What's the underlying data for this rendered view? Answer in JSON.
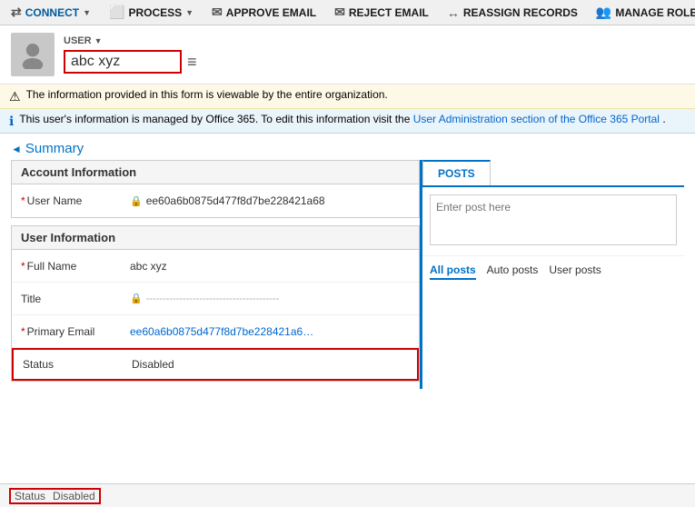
{
  "toolbar": {
    "connect_label": "CONNECT",
    "process_label": "PROCESS",
    "approve_email_label": "APPROVE EMAIL",
    "reject_email_label": "REJECT EMAIL",
    "reassign_records_label": "REASSIGN RECORDS",
    "manage_roles_label": "MANAGE ROLES"
  },
  "header": {
    "user_label": "USER",
    "name_value": "abc xyz"
  },
  "notices": {
    "warning_text": "The information provided in this form is viewable by the entire organization.",
    "info_text": "This user's information is managed by Office 365. To edit this information visit the ",
    "info_link": "User Administration section of the Office 365 Portal",
    "info_text2": "."
  },
  "summary": {
    "label": "Summary"
  },
  "account_section": {
    "header": "Account Information",
    "username_label": "User Name",
    "username_value": "ee60a6b0875d477f8d7be228421a68"
  },
  "user_section": {
    "header": "User Information",
    "fullname_label": "Full Name",
    "fullname_value": "abc xyz",
    "title_label": "Title",
    "title_value": "----------------------------------------",
    "email_label": "Primary Email",
    "email_value": "ee60a6b0875d477f8d7be228421a6…",
    "status_label": "Status",
    "status_value": "Disabled"
  },
  "posts": {
    "tab_label": "POSTS",
    "post_placeholder": "Enter post here",
    "filter_all": "All posts",
    "filter_auto": "Auto posts",
    "filter_user": "User posts"
  },
  "bottom_status": {
    "label": "Status",
    "value": "Disabled"
  }
}
